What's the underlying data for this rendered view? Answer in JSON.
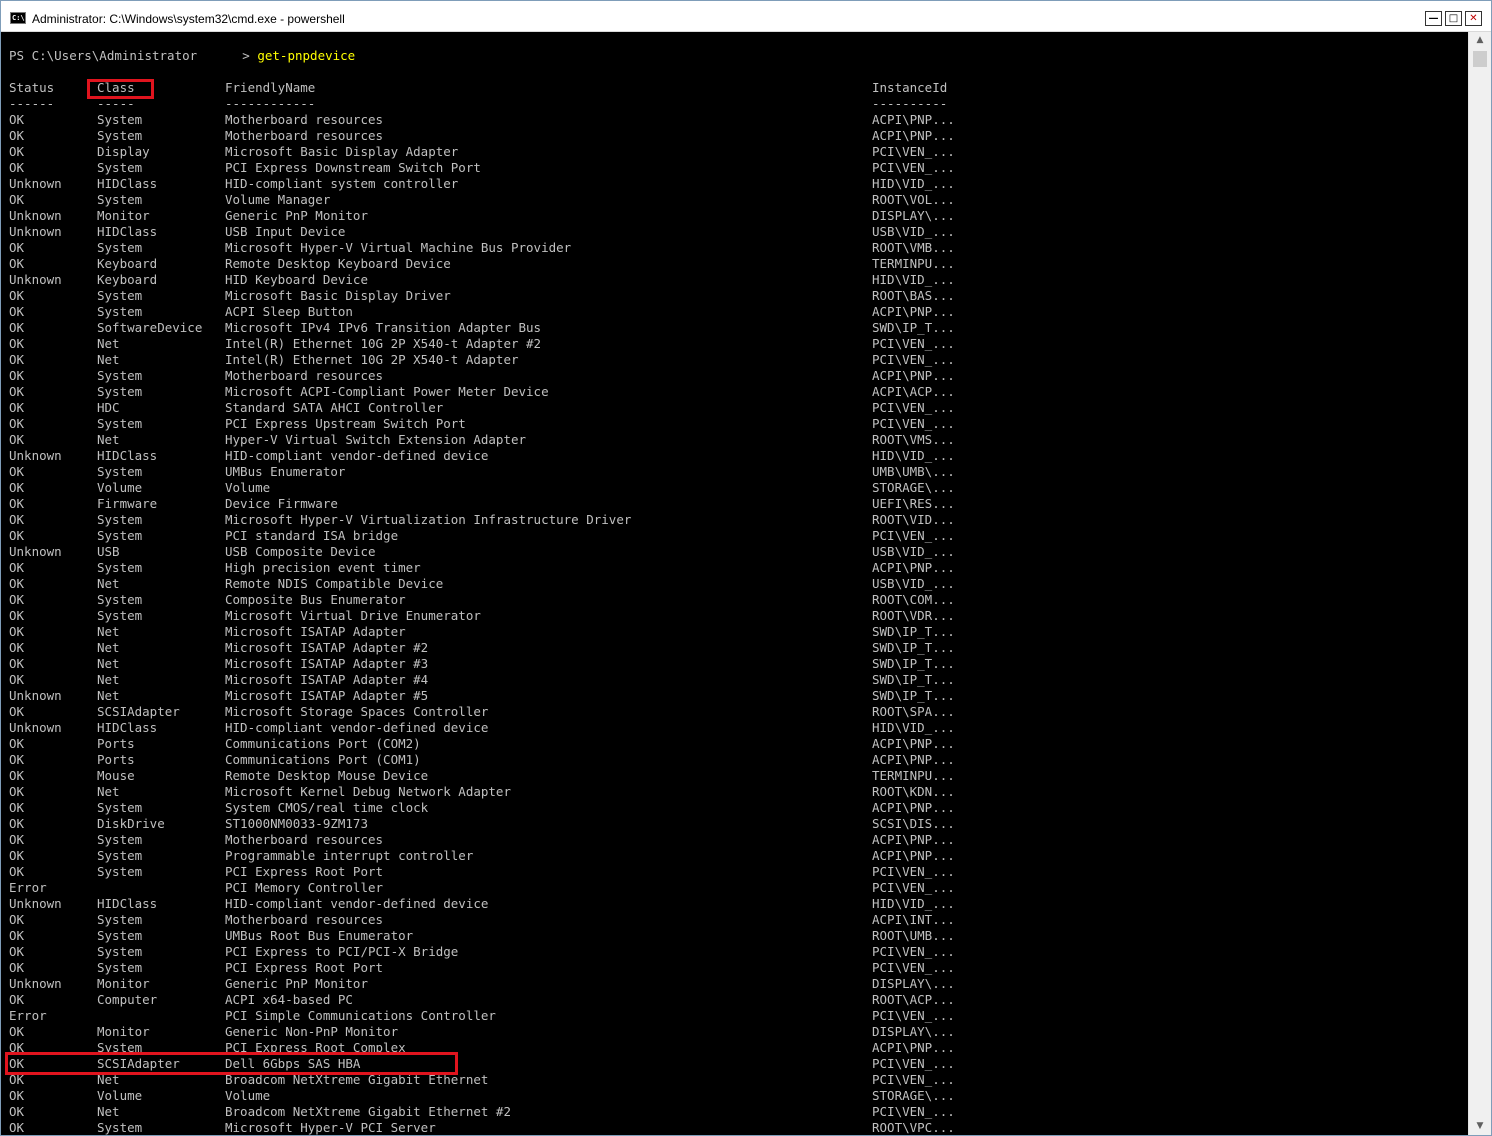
{
  "window": {
    "title": "Administrator: C:\\Windows\\system32\\cmd.exe - powershell",
    "icon_label": "C:\\",
    "minimize_glyph": "—",
    "maximize_glyph": "□",
    "close_glyph": "✕"
  },
  "console": {
    "prompt": "PS C:\\Users\\Administrator      > ",
    "command": "get-pnpdevice",
    "headers": [
      "Status",
      "Class",
      "FriendlyName",
      "InstanceId"
    ],
    "underlines": [
      "------",
      "-----",
      "------------",
      "----------"
    ],
    "rows": [
      [
        "OK",
        "System",
        "Motherboard resources",
        "ACPI\\PNP..."
      ],
      [
        "OK",
        "System",
        "Motherboard resources",
        "ACPI\\PNP..."
      ],
      [
        "OK",
        "Display",
        "Microsoft Basic Display Adapter",
        "PCI\\VEN_..."
      ],
      [
        "OK",
        "System",
        "PCI Express Downstream Switch Port",
        "PCI\\VEN_..."
      ],
      [
        "Unknown",
        "HIDClass",
        "HID-compliant system controller",
        "HID\\VID_..."
      ],
      [
        "OK",
        "System",
        "Volume Manager",
        "ROOT\\VOL..."
      ],
      [
        "Unknown",
        "Monitor",
        "Generic PnP Monitor",
        "DISPLAY\\..."
      ],
      [
        "Unknown",
        "HIDClass",
        "USB Input Device",
        "USB\\VID_..."
      ],
      [
        "OK",
        "System",
        "Microsoft Hyper-V Virtual Machine Bus Provider",
        "ROOT\\VMB..."
      ],
      [
        "OK",
        "Keyboard",
        "Remote Desktop Keyboard Device",
        "TERMINPU..."
      ],
      [
        "Unknown",
        "Keyboard",
        "HID Keyboard Device",
        "HID\\VID_..."
      ],
      [
        "OK",
        "System",
        "Microsoft Basic Display Driver",
        "ROOT\\BAS..."
      ],
      [
        "OK",
        "System",
        "ACPI Sleep Button",
        "ACPI\\PNP..."
      ],
      [
        "OK",
        "SoftwareDevice",
        "Microsoft IPv4 IPv6 Transition Adapter Bus",
        "SWD\\IP_T..."
      ],
      [
        "OK",
        "Net",
        "Intel(R) Ethernet 10G 2P X540-t Adapter #2",
        "PCI\\VEN_..."
      ],
      [
        "OK",
        "Net",
        "Intel(R) Ethernet 10G 2P X540-t Adapter",
        "PCI\\VEN_..."
      ],
      [
        "OK",
        "System",
        "Motherboard resources",
        "ACPI\\PNP..."
      ],
      [
        "OK",
        "System",
        "Microsoft ACPI-Compliant Power Meter Device",
        "ACPI\\ACP..."
      ],
      [
        "OK",
        "HDC",
        "Standard SATA AHCI Controller",
        "PCI\\VEN_..."
      ],
      [
        "OK",
        "System",
        "PCI Express Upstream Switch Port",
        "PCI\\VEN_..."
      ],
      [
        "OK",
        "Net",
        "Hyper-V Virtual Switch Extension Adapter",
        "ROOT\\VMS..."
      ],
      [
        "Unknown",
        "HIDClass",
        "HID-compliant vendor-defined device",
        "HID\\VID_..."
      ],
      [
        "OK",
        "System",
        "UMBus Enumerator",
        "UMB\\UMB\\..."
      ],
      [
        "OK",
        "Volume",
        "Volume",
        "STORAGE\\..."
      ],
      [
        "OK",
        "Firmware",
        "Device Firmware",
        "UEFI\\RES..."
      ],
      [
        "OK",
        "System",
        "Microsoft Hyper-V Virtualization Infrastructure Driver",
        "ROOT\\VID..."
      ],
      [
        "OK",
        "System",
        "PCI standard ISA bridge",
        "PCI\\VEN_..."
      ],
      [
        "Unknown",
        "USB",
        "USB Composite Device",
        "USB\\VID_..."
      ],
      [
        "OK",
        "System",
        "High precision event timer",
        "ACPI\\PNP..."
      ],
      [
        "OK",
        "Net",
        "Remote NDIS Compatible Device",
        "USB\\VID_..."
      ],
      [
        "OK",
        "System",
        "Composite Bus Enumerator",
        "ROOT\\COM..."
      ],
      [
        "OK",
        "System",
        "Microsoft Virtual Drive Enumerator",
        "ROOT\\VDR..."
      ],
      [
        "OK",
        "Net",
        "Microsoft ISATAP Adapter",
        "SWD\\IP_T..."
      ],
      [
        "OK",
        "Net",
        "Microsoft ISATAP Adapter #2",
        "SWD\\IP_T..."
      ],
      [
        "OK",
        "Net",
        "Microsoft ISATAP Adapter #3",
        "SWD\\IP_T..."
      ],
      [
        "OK",
        "Net",
        "Microsoft ISATAP Adapter #4",
        "SWD\\IP_T..."
      ],
      [
        "Unknown",
        "Net",
        "Microsoft ISATAP Adapter #5",
        "SWD\\IP_T..."
      ],
      [
        "OK",
        "SCSIAdapter",
        "Microsoft Storage Spaces Controller",
        "ROOT\\SPA..."
      ],
      [
        "Unknown",
        "HIDClass",
        "HID-compliant vendor-defined device",
        "HID\\VID_..."
      ],
      [
        "OK",
        "Ports",
        "Communications Port (COM2)",
        "ACPI\\PNP..."
      ],
      [
        "OK",
        "Ports",
        "Communications Port (COM1)",
        "ACPI\\PNP..."
      ],
      [
        "OK",
        "Mouse",
        "Remote Desktop Mouse Device",
        "TERMINPU..."
      ],
      [
        "OK",
        "Net",
        "Microsoft Kernel Debug Network Adapter",
        "ROOT\\KDN..."
      ],
      [
        "OK",
        "System",
        "System CMOS/real time clock",
        "ACPI\\PNP..."
      ],
      [
        "OK",
        "DiskDrive",
        "ST1000NM0033-9ZM173",
        "SCSI\\DIS..."
      ],
      [
        "OK",
        "System",
        "Motherboard resources",
        "ACPI\\PNP..."
      ],
      [
        "OK",
        "System",
        "Programmable interrupt controller",
        "ACPI\\PNP..."
      ],
      [
        "OK",
        "System",
        "PCI Express Root Port",
        "PCI\\VEN_..."
      ],
      [
        "Error",
        "",
        "PCI Memory Controller",
        "PCI\\VEN_..."
      ],
      [
        "Unknown",
        "HIDClass",
        "HID-compliant vendor-defined device",
        "HID\\VID_..."
      ],
      [
        "OK",
        "System",
        "Motherboard resources",
        "ACPI\\INT..."
      ],
      [
        "OK",
        "System",
        "UMBus Root Bus Enumerator",
        "ROOT\\UMB..."
      ],
      [
        "OK",
        "System",
        "PCI Express to PCI/PCI-X Bridge",
        "PCI\\VEN_..."
      ],
      [
        "OK",
        "System",
        "PCI Express Root Port",
        "PCI\\VEN_..."
      ],
      [
        "Unknown",
        "Monitor",
        "Generic PnP Monitor",
        "DISPLAY\\..."
      ],
      [
        "OK",
        "Computer",
        "ACPI x64-based PC",
        "ROOT\\ACP..."
      ],
      [
        "Error",
        "",
        "PCI Simple Communications Controller",
        "PCI\\VEN_..."
      ],
      [
        "OK",
        "Monitor",
        "Generic Non-PnP Monitor",
        "DISPLAY\\..."
      ],
      [
        "OK",
        "System",
        "PCI Express Root Complex",
        "ACPI\\PNP..."
      ],
      [
        "OK",
        "SCSIAdapter",
        "Dell 6Gbps SAS HBA",
        "PCI\\VEN_..."
      ],
      [
        "OK",
        "Net",
        "Broadcom NetXtreme Gigabit Ethernet",
        "PCI\\VEN_..."
      ],
      [
        "OK",
        "Volume",
        "Volume",
        "STORAGE\\..."
      ],
      [
        "OK",
        "Net",
        "Broadcom NetXtreme Gigabit Ethernet #2",
        "PCI\\VEN_..."
      ],
      [
        "OK",
        "System",
        "Microsoft Hyper-V PCI Server",
        "ROOT\\VPC..."
      ]
    ]
  },
  "scrollbar": {
    "up_glyph": "▲",
    "down_glyph": "▼"
  },
  "colors": {
    "background": "#000000",
    "text": "#c0c0c0",
    "command": "#ffff00",
    "highlight": "#e0141e"
  }
}
